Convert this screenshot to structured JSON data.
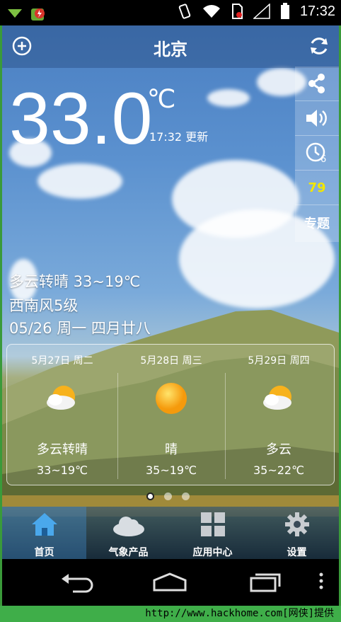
{
  "status_bar": {
    "time": "17:32"
  },
  "header": {
    "city": "北京"
  },
  "current": {
    "temperature": "33.0",
    "unit": "℃",
    "update_time": "17:32 更新",
    "condition_line": "多云转晴  33~19℃",
    "wind": "西南风5级",
    "date_line": "05/26  周一  四月廿八"
  },
  "side_panel": {
    "alarm_badge": "6",
    "count": "79",
    "topic": "专题"
  },
  "forecast": [
    {
      "date": "5月27日 周二",
      "icon": "partly-cloudy-icon",
      "desc": "多云转晴",
      "range": "33~19℃"
    },
    {
      "date": "5月28日 周三",
      "icon": "sunny-icon",
      "desc": "晴",
      "range": "35~19℃"
    },
    {
      "date": "5月29日 周四",
      "icon": "partly-cloudy-icon",
      "desc": "多云",
      "range": "35~22℃"
    }
  ],
  "tabs": [
    {
      "label": "首页",
      "icon": "home-icon",
      "active": true
    },
    {
      "label": "气象产品",
      "icon": "cloud-icon",
      "active": false
    },
    {
      "label": "应用中心",
      "icon": "grid-icon",
      "active": false
    },
    {
      "label": "设置",
      "icon": "gear-icon",
      "active": false
    }
  ],
  "watermark": "http://www.hackhome.com[网侠]提供"
}
